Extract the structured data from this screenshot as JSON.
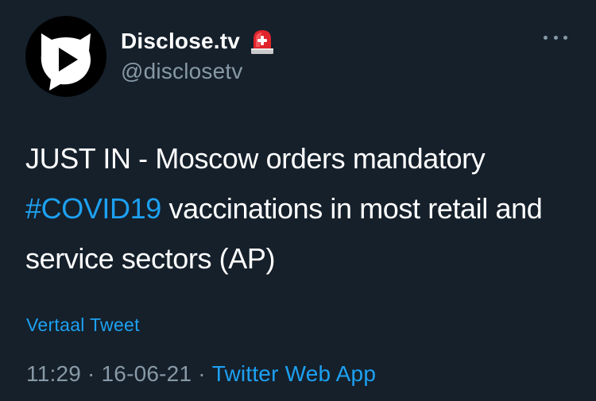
{
  "author": {
    "display_name": "Disclose.tv",
    "handle": "@disclosetv",
    "badge_icon": "rotating-light-icon"
  },
  "tweet": {
    "text_before": "JUST IN - Moscow orders mandatory ",
    "hashtag": "#COVID19",
    "text_after": " vaccinations in most retail and service sectors (AP)"
  },
  "translate_label": "Vertaal Tweet",
  "meta": {
    "time": "11:29",
    "separator": "·",
    "date": "16-06-21",
    "source": "Twitter Web App"
  },
  "colors": {
    "background": "#15202b",
    "accent": "#1da1f2",
    "secondary_text": "#8899a6"
  }
}
